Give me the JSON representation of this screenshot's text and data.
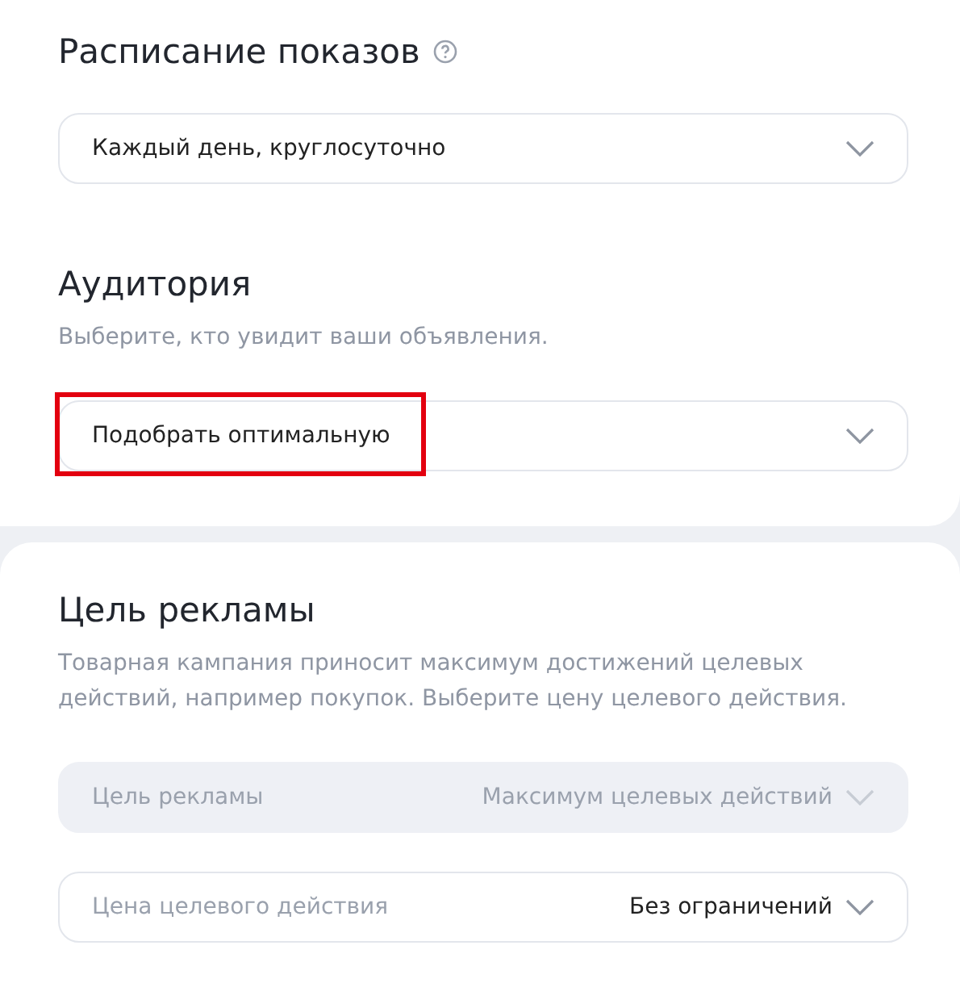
{
  "sections": [
    {
      "title": "Расписание показов",
      "help_icon": true,
      "fields": [
        {
          "value": "Каждый день, круглосуточно",
          "disabled": false,
          "highlighted": false
        }
      ]
    },
    {
      "title": "Аудитория",
      "description": "Выберите, кто увидит ваши объявления.",
      "fields": [
        {
          "value": "Подобрать оптимальную",
          "disabled": false,
          "highlighted": true
        }
      ]
    },
    {
      "title": "Цель рекламы",
      "description": "Товарная кампания приносит максимум достижений целевых действий, например покупок. Выберите цену целевого действия.",
      "fields": [
        {
          "label": "Цель рекламы",
          "value": "Максимум целевых действий",
          "disabled": true,
          "highlighted": false
        },
        {
          "label": "Цена целевого действия",
          "value": "Без ограничений",
          "disabled": false,
          "highlighted": false
        }
      ]
    }
  ]
}
